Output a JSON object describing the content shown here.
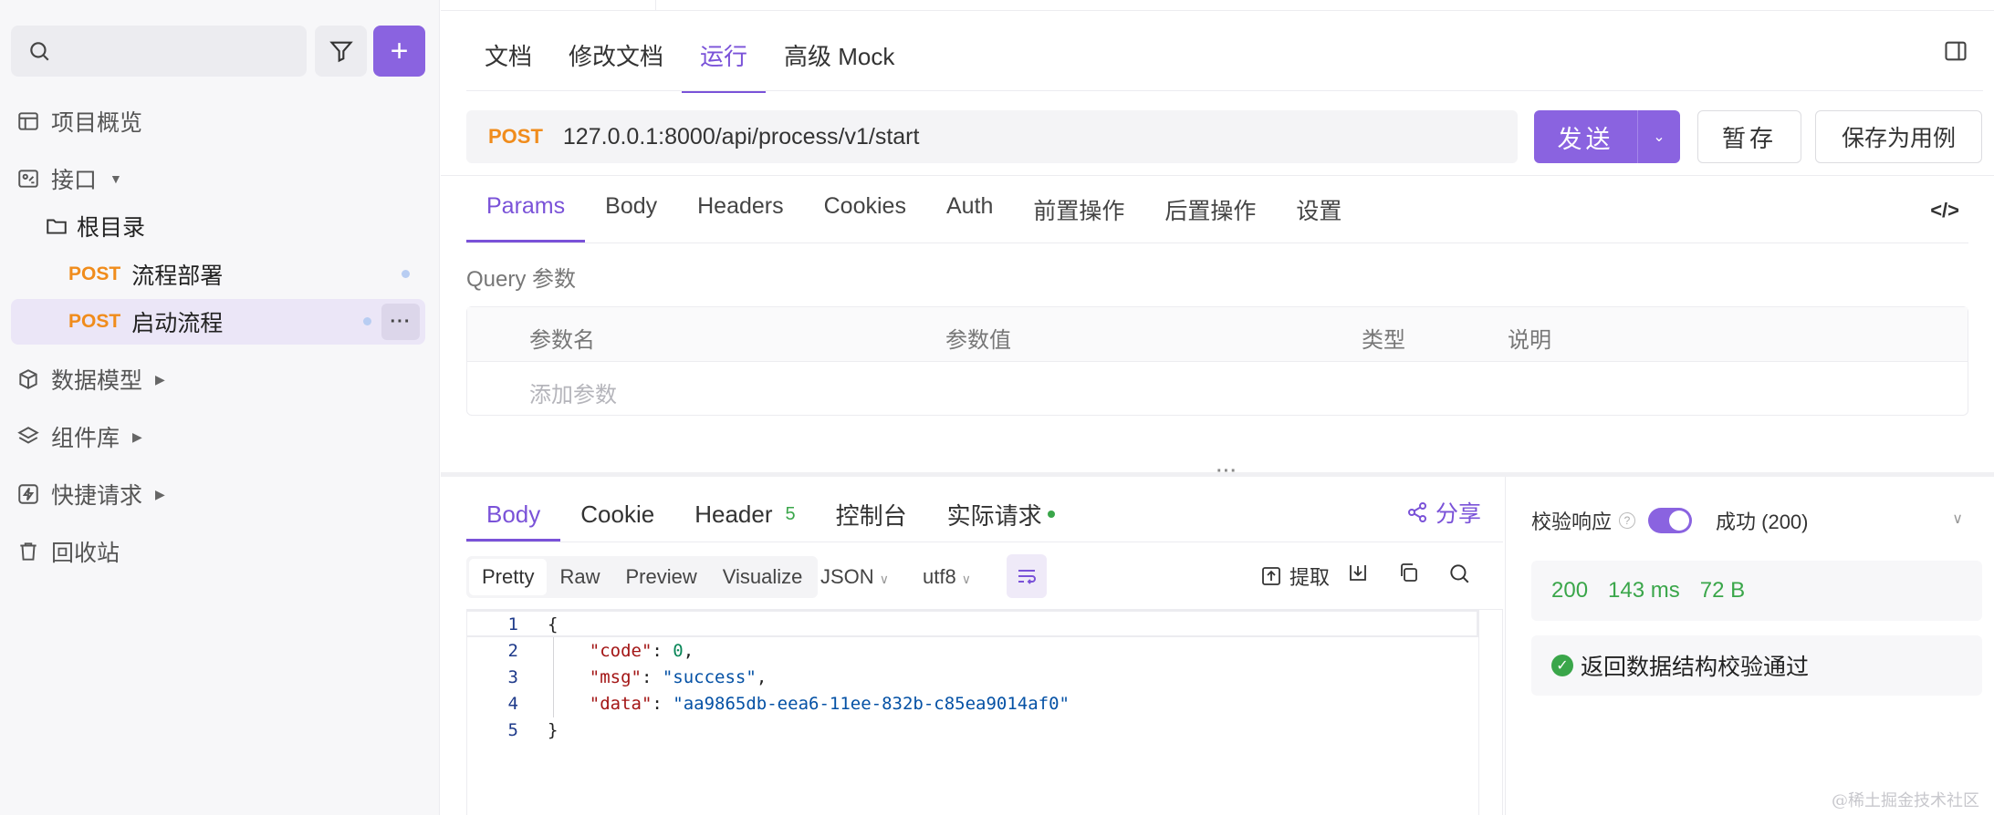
{
  "sidebar": {
    "search": {
      "placeholder": ""
    },
    "nav": [
      {
        "label": "项目概览",
        "icon": "layout-icon"
      },
      {
        "label": "接口",
        "icon": "api-icon",
        "caret": "▼"
      },
      {
        "label": "数据模型",
        "icon": "box-icon",
        "caret": "▶"
      },
      {
        "label": "组件库",
        "icon": "layers-icon",
        "caret": "▶"
      },
      {
        "label": "快捷请求",
        "icon": "lightning-icon",
        "caret": "▶"
      },
      {
        "label": "回收站",
        "icon": "trash-icon"
      }
    ],
    "folder": {
      "label": "根目录"
    },
    "apis": [
      {
        "method": "POST",
        "name": "流程部署"
      },
      {
        "method": "POST",
        "name": "启动流程"
      }
    ]
  },
  "doc_tabs": [
    "文档",
    "修改文档",
    "运行",
    "高级 Mock"
  ],
  "request": {
    "method": "POST",
    "url": "127.0.0.1:8000/api/process/v1/start",
    "send_label": "发送",
    "save_label": "暂存",
    "save_case_label": "保存为用例"
  },
  "req_tabs": [
    "Params",
    "Body",
    "Headers",
    "Cookies",
    "Auth",
    "前置操作",
    "后置操作",
    "设置"
  ],
  "params": {
    "section_label": "Query 参数",
    "columns": [
      "参数名",
      "参数值",
      "类型",
      "说明"
    ],
    "add_placeholder": "添加参数"
  },
  "response": {
    "tabs": [
      "Body",
      "Cookie",
      "Header",
      "控制台",
      "实际请求"
    ],
    "header_count": "5",
    "share_label": "分享",
    "formats": [
      "Pretty",
      "Raw",
      "Preview",
      "Visualize"
    ],
    "lang": "JSON",
    "encoding": "utf8",
    "extract_label": "提取",
    "body_lines": [
      {
        "n": "1",
        "text": "{"
      },
      {
        "n": "2",
        "key": "\"code\"",
        "sep": ": ",
        "val": "0",
        "kind": "num",
        "tail": ","
      },
      {
        "n": "3",
        "key": "\"msg\"",
        "sep": ": ",
        "val": "\"success\"",
        "kind": "str",
        "tail": ","
      },
      {
        "n": "4",
        "key": "\"data\"",
        "sep": ": ",
        "val": "\"aa9865db-eea6-11ee-832b-c85ea9014af0\"",
        "kind": "str",
        "tail": ""
      },
      {
        "n": "5",
        "text": "}"
      }
    ]
  },
  "validation": {
    "label": "校验响应",
    "enabled": true,
    "status": "成功 (200)",
    "code": "200",
    "time": "143 ms",
    "size": "72 B",
    "result": "返回数据结构校验通过"
  },
  "watermark": "@稀土掘金技术社区",
  "colors": {
    "accent": "#8a63e0",
    "post": "#f08c1c",
    "success": "#3aa64a"
  }
}
